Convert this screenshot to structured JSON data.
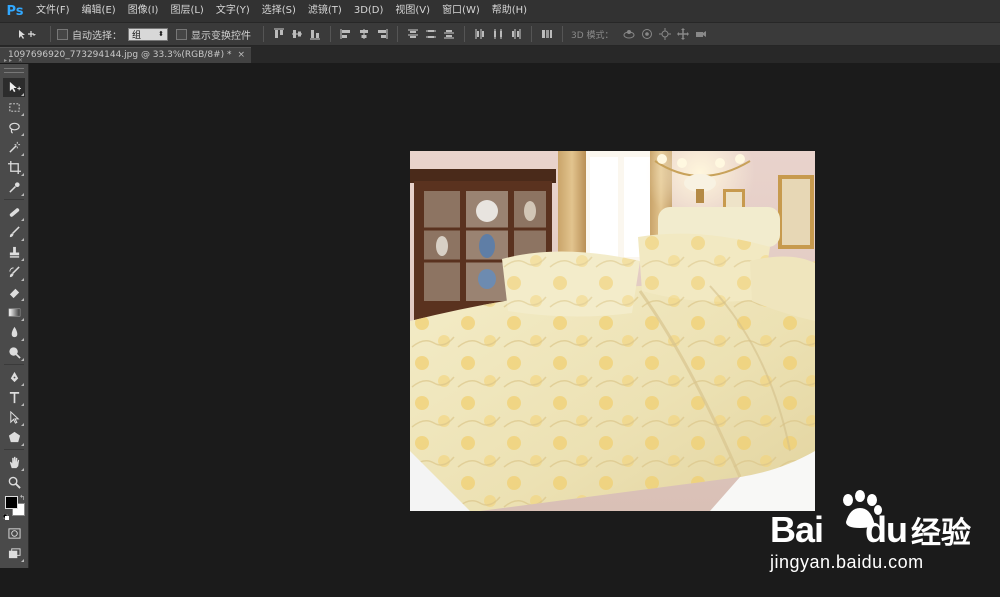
{
  "app": {
    "logo": "Ps"
  },
  "menu": [
    "文件(F)",
    "编辑(E)",
    "图像(I)",
    "图层(L)",
    "文字(Y)",
    "选择(S)",
    "滤镜(T)",
    "3D(D)",
    "视图(V)",
    "窗口(W)",
    "帮助(H)"
  ],
  "options": {
    "auto_select_label": "自动选择：",
    "auto_select_value": "组",
    "show_transform_label": "显示变换控件",
    "mode_label": "3D 模式："
  },
  "document": {
    "tab_title": "1097696920_773294144.jpg @ 33.3%(RGB/8#) *",
    "close_glyph": "×"
  },
  "watermark": {
    "brand": "Bai",
    "brand_tail": "du",
    "brand_cn": "经验",
    "url": "jingyan.baidu.com"
  },
  "colors": {
    "foreground": "#000000",
    "background": "#ffffff",
    "accent": "#31a8ff"
  }
}
